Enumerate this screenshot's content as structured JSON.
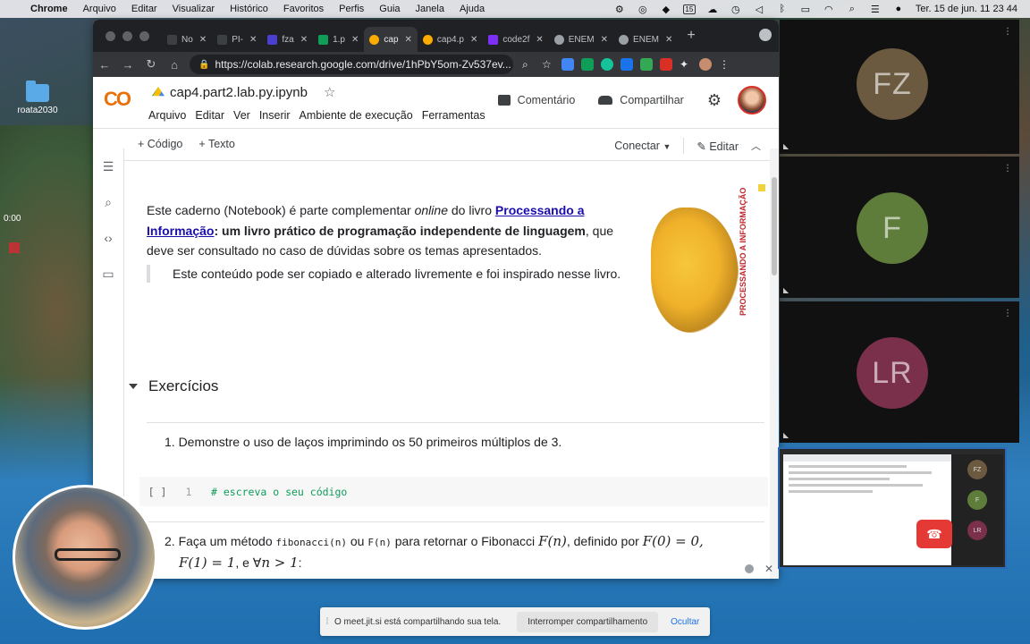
{
  "menubar": {
    "app": "Chrome",
    "items": [
      "Arquivo",
      "Editar",
      "Visualizar",
      "Histórico",
      "Favoritos",
      "Perfis",
      "Guia",
      "Janela",
      "Ajuda"
    ],
    "calendar_day": "15",
    "datetime": "Ter. 15 de jun.  11 23 44"
  },
  "desktop": {
    "folder_label": "roata2030",
    "recording_time": "0:00"
  },
  "browser": {
    "tabs": [
      {
        "label": "No",
        "color": "#202124"
      },
      {
        "label": "PI-",
        "color": "#202124"
      },
      {
        "label": "fza",
        "color": "#4a3fcf"
      },
      {
        "label": "1.p",
        "color": "#0f9d58"
      },
      {
        "label": "cap",
        "color": "#f9ab00",
        "active": true
      },
      {
        "label": "cap4.p",
        "color": "#f9ab00"
      },
      {
        "label": "code2f",
        "color": "#7b2ff7"
      },
      {
        "label": "ENEM",
        "color": "#5f6368"
      },
      {
        "label": "ENEM",
        "color": "#5f6368"
      }
    ],
    "new_tab": "+",
    "url": "https://colab.research.google.com/drive/1hPbY5om-Zv537ev..."
  },
  "colab": {
    "logo": "CO",
    "notebook_title": "cap4.part2.lab.py.ipynb",
    "menu": [
      "Arquivo",
      "Editar",
      "Ver",
      "Inserir",
      "Ambiente de execução",
      "Ferramentas"
    ],
    "comment_label": "Comentário",
    "share_label": "Compartilhar",
    "add_code": "+ Código",
    "add_text": "+ Texto",
    "connect": "Conectar",
    "edit": "Editar"
  },
  "content": {
    "intro_part1": "Este caderno (Notebook) é parte complementar ",
    "intro_online": "online",
    "intro_part2": " do livro ",
    "intro_link": "Processando a Informação",
    "intro_bold": ": um livro prático de programação independente de linguagem",
    "intro_part3": ", que deve ser consultado no caso de dúvidas sobre os temas apresentados.",
    "quote": "Este conteúdo pode ser copiado e alterado livremente e foi inspirado nesse livro.",
    "book_side": "PROCESSANDO A INFORMAÇÃO",
    "section_title": "Exercícios",
    "ex1": "1. Demonstre o uso de laços imprimindo os 50 primeiros múltiplos de 3.",
    "cell_run": "[ ]",
    "cell_line": "1",
    "cell_code": "# escreva o seu código",
    "ex2_a": "2. Faça um método ",
    "ex2_code1": "fibonacci(n)",
    "ex2_b": " ou ",
    "ex2_code2": "F(n)",
    "ex2_c": " para retornar o Fibonacci ",
    "ex2_math1": "F(n)",
    "ex2_d": ", definido por ",
    "ex2_math2": "F(0) = 0,",
    "ex2_math3": "F(1) = 1",
    "ex2_e": ", e ∀",
    "ex2_math4": "n > 1",
    "ex2_f": ":"
  },
  "participants": [
    {
      "initials": "FZ",
      "color": "#6b5a3f"
    },
    {
      "initials": "F",
      "color": "#5f7d3a"
    },
    {
      "initials": "LR",
      "color": "#7a2f4b"
    }
  ],
  "share_banner": {
    "message": "O meet.jit.si está compartilhando sua tela.",
    "stop": "Interromper compartilhamento",
    "hide": "Ocultar"
  }
}
